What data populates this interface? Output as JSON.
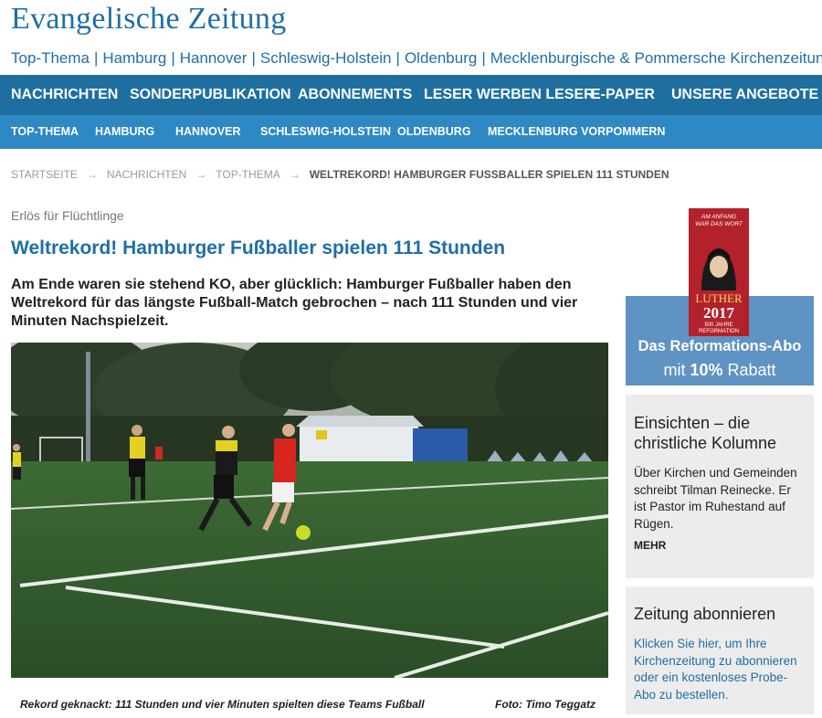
{
  "masthead": "Evangelische Zeitung",
  "regions": [
    "Top-Thema",
    "Hamburg",
    "Hannover",
    "Schleswig-Holstein",
    "Oldenburg",
    "Mecklenburgische & Pommersche Kirchenzeitung"
  ],
  "region_separator": "|",
  "main_nav": [
    "NACHRICHTEN",
    "SONDERPUBLIKATION",
    "ABONNEMENTS",
    "LESER WERBEN LESER",
    "E-PAPER",
    "UNSERE ANGEBOTE"
  ],
  "sub_nav": [
    "TOP-THEMA",
    "HAMBURG",
    "HANNOVER",
    "SCHLESWIG-HOLSTEIN",
    "OLDENBURG",
    "MECKLENBURG VORPOMMERN"
  ],
  "breadcrumb": {
    "arrow": "→",
    "items": [
      "STARTSEITE",
      "NACHRICHTEN",
      "TOP-THEMA"
    ],
    "current": "WELTREKORD! HAMBURGER FUSSBALLER SPIELEN 111 STUNDEN"
  },
  "article": {
    "kicker": "Erlös für Flüchtlinge",
    "headline": "Weltrekord! Hamburger Fußballer spielen 111 Stunden",
    "lead": "Am Ende waren sie stehend KO, aber glücklich: Hamburger Fußballer haben den Weltrekord für das längste Fußball-Match gebrochen – nach 111 Stunden und vier Minuten Nachspielzeit.",
    "caption": "Rekord geknackt: 111 Stunden und vier Minuten spielten diese Teams Fußball",
    "credit": "Foto: Timo Teggatz"
  },
  "ad": {
    "book_top": "AM ANFANG WAR DAS WORT",
    "book_word": "LUTHER",
    "book_year": "2017",
    "book_bottom": "500 JAHRE REFORMATION",
    "line1": "Das Reformations-Abo",
    "line2_prefix": "mit ",
    "line2_bold": "10%",
    "line2_suffix": " Rabatt"
  },
  "column_card": {
    "title": "Einsichten – die christliche Kolumne",
    "text": "Über Kirchen und Gemeinden schreibt Tilman Reinecke. Er ist Pastor im Ruhestand auf Rügen.",
    "more": "MEHR"
  },
  "subscribe_card": {
    "title": "Zeitung abonnieren",
    "text": "Klicken Sie hier, um Ihre Kirchenzeitung zu abonnieren oder ein kostenloses Probe-Abo zu bestellen."
  },
  "colors": {
    "brand_blue": "#1f6fa5",
    "nav_dark": "#1e6f9f",
    "nav_light": "#2e88c4",
    "ad_blue": "#5f93c3",
    "book_red": "#b3212a",
    "card_bg": "#ececec"
  }
}
